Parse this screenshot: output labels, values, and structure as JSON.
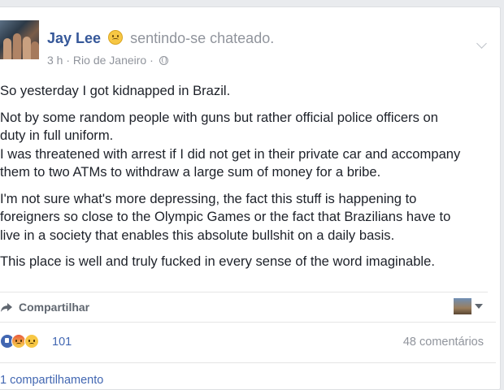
{
  "post": {
    "author": "Jay Lee",
    "feeling": "sentindo-se chateado.",
    "time": "3 h",
    "separator": "·",
    "location": "Rio de Janeiro",
    "separator2": "·",
    "paragraphs": [
      [
        "So yesterday I got kidnapped in Brazil."
      ],
      [
        "Not by some random people with guns but rather official police officers on",
        "duty in full uniform.",
        "I was threatened with arrest if I did not get in their private car and accompany",
        "them to two ATMs to withdraw a large sum of money for a bribe."
      ],
      [
        "I'm not sure what's more depressing, the fact this stuff is happening to",
        "foreigners so close to the Olympic Games or the fact that Brazilians have to",
        "live in a society that enables this absolute bullshit on a daily basis."
      ],
      [
        "This place is well and truly fucked in every sense of the word imaginable."
      ]
    ]
  },
  "actions": {
    "share_label": "Compartilhar"
  },
  "stats": {
    "reaction_count": "101",
    "comments": "48 comentários",
    "shares": "1 compartilhamento"
  },
  "icons": {
    "feeling": "sad-face-icon",
    "privacy": "globe-icon",
    "share": "share-arrow-icon",
    "menu": "chevron-down-icon",
    "reactions": [
      "like-icon",
      "angry-icon",
      "sad-icon"
    ]
  },
  "colors": {
    "link": "#365899",
    "muted": "#90949c",
    "reaction_blue": "#4267b2"
  }
}
